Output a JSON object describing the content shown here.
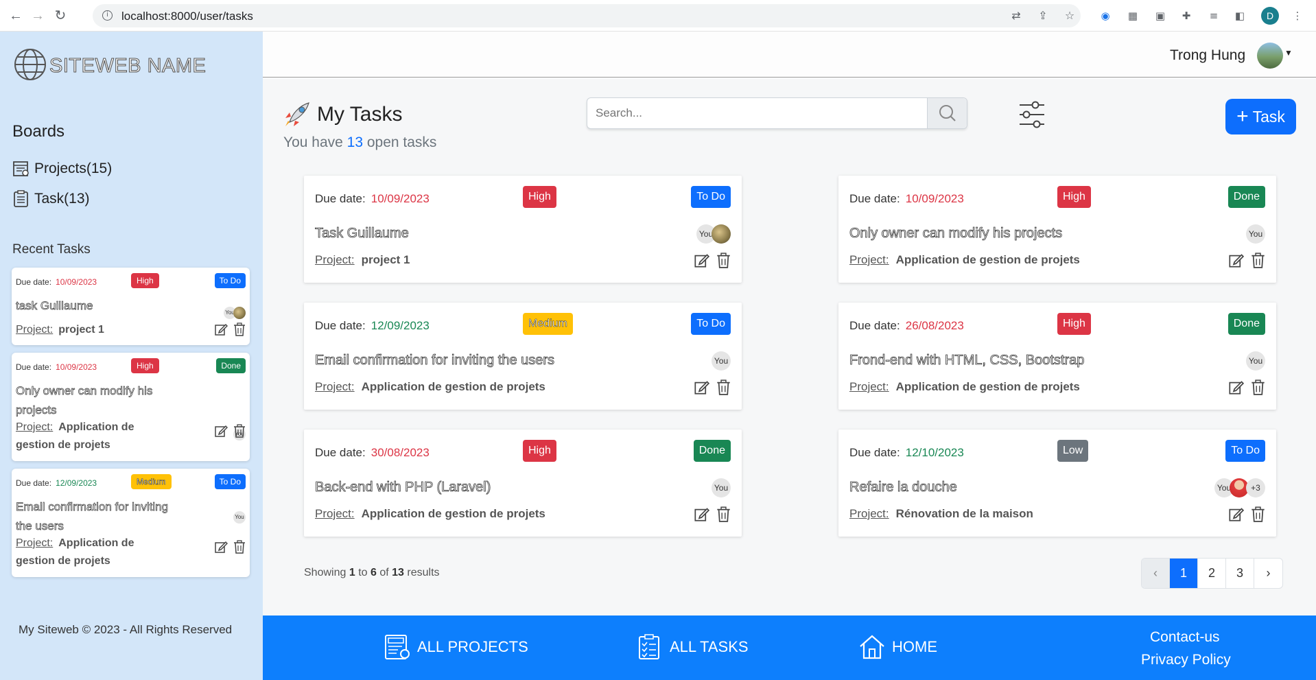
{
  "browser": {
    "url": "localhost:8000/user/tasks",
    "profile_initial": "D"
  },
  "sidebar": {
    "site_name": "SITEWEB NAME",
    "boards_title": "Boards",
    "boards": [
      {
        "label": "Projects(15)",
        "icon": "projects-board-icon"
      },
      {
        "label": "Task(13)",
        "icon": "tasks-checklist-icon"
      }
    ],
    "recent_title": "Recent Tasks",
    "recent": [
      {
        "due_label": "Due date:",
        "due": "10/09/2023",
        "due_color": "#dc3545",
        "priority": "High",
        "status": "To Do",
        "title": "task Guillaume",
        "assignee_you": "You",
        "project_label": "Project:",
        "project": "project 1"
      },
      {
        "due_label": "Due date:",
        "due": "10/09/2023",
        "due_color": "#dc3545",
        "priority": "High",
        "status": "Done",
        "title": "Only owner can modify his projects",
        "assignee_you": "You",
        "project_label": "Project:",
        "project": "Application de gestion de projets"
      },
      {
        "due_label": "Due date:",
        "due": "12/09/2023",
        "due_color": "#198754",
        "priority": "Medium",
        "status": "To Do",
        "title": "Email confirmation for inviting the users",
        "assignee_you": "You",
        "project_label": "Project:",
        "project": "Application de gestion de projets"
      }
    ],
    "copyright": "My Siteweb © 2023 - All Rights Reserved"
  },
  "header": {
    "user_name": "Trong Hung"
  },
  "main": {
    "title": "My Tasks",
    "subtitle_prefix": "You have",
    "open_count": "13",
    "subtitle_suffix": "open tasks",
    "search_placeholder": "Search...",
    "add_button": "Task",
    "tasks": [
      {
        "due_label": "Due date:",
        "due": "10/09/2023",
        "due_color": "#dc3545",
        "priority": "High",
        "status": "To Do",
        "title": "Task Guillaume",
        "assignee_you": "You",
        "project_label": "Project:",
        "project": "project 1"
      },
      {
        "due_label": "Due date:",
        "due": "10/09/2023",
        "due_color": "#dc3545",
        "priority": "High",
        "status": "Done",
        "title": "Only owner can modify his projects",
        "assignee_you": "You",
        "project_label": "Project:",
        "project": "Application de gestion de projets"
      },
      {
        "due_label": "Due date:",
        "due": "12/09/2023",
        "due_color": "#198754",
        "priority": "Medium",
        "status": "To Do",
        "title": "Email confirmation for inviting the users",
        "assignee_you": "You",
        "project_label": "Project:",
        "project": "Application de gestion de projets"
      },
      {
        "due_label": "Due date:",
        "due": "26/08/2023",
        "due_color": "#dc3545",
        "priority": "High",
        "status": "Done",
        "title": "Frond-end with HTML, CSS, Bootstrap",
        "assignee_you": "You",
        "project_label": "Project:",
        "project": "Application de gestion de projets"
      },
      {
        "due_label": "Due date:",
        "due": "30/08/2023",
        "due_color": "#dc3545",
        "priority": "High",
        "status": "Done",
        "title": "Back-end with PHP (Laravel)",
        "assignee_you": "You",
        "project_label": "Project:",
        "project": "Application de gestion de projets"
      },
      {
        "due_label": "Due date:",
        "due": "12/10/2023",
        "due_color": "#198754",
        "priority": "Low",
        "status": "To Do",
        "title": "Refaire la douche",
        "assignee_you": "You",
        "assignee_more": "+3",
        "project_label": "Project:",
        "project": "Rénovation de la maison"
      }
    ],
    "pagination": {
      "showing": "Showing",
      "from": "1",
      "to_word": "to",
      "to": "6",
      "of_word": "of",
      "total": "13",
      "results": "results",
      "prev": "‹",
      "pages": [
        "1",
        "2",
        "3"
      ],
      "next": "›",
      "current": "1"
    }
  },
  "footer": {
    "all_projects": "ALL PROJECTS",
    "all_tasks": "ALL TASKS",
    "home": "HOME",
    "contact": "Contact-us",
    "privacy": "Privacy Policy"
  },
  "colors": {
    "accent": "#0d6efd",
    "footer": "#0d7ffd",
    "sidebar": "#d3e6f9",
    "high": "#dc3545",
    "medium": "#ffc107",
    "low": "#6c757d",
    "done": "#198754"
  }
}
